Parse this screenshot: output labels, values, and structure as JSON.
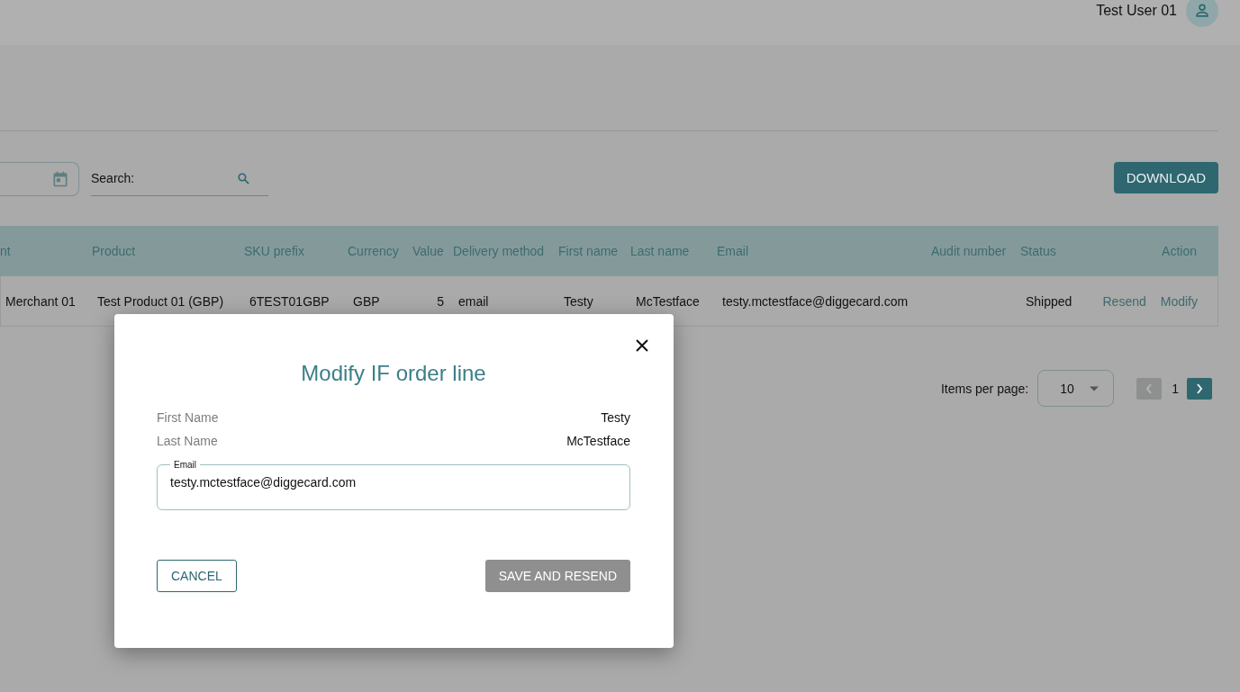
{
  "header": {
    "user_name": "Test User 01"
  },
  "filters": {
    "search": {
      "label": "Search:"
    },
    "download": "DOWNLOAD"
  },
  "table": {
    "columns": [
      "nt",
      "Product",
      "SKU prefix",
      "Currency",
      "Value",
      "Delivery method",
      "First name",
      "Last name",
      "Email",
      "Audit number",
      "Status",
      "Action"
    ],
    "rows": [
      {
        "cells": [
          "Merchant 01",
          "Test Product 01 (GBP)",
          "6TEST01GBP",
          "GBP",
          "5",
          "email",
          "Testy",
          "McTestface",
          "testy.mctestface@diggecard.com",
          "",
          "Shipped"
        ],
        "actions": [
          "Resend",
          "Modify"
        ]
      }
    ]
  },
  "pagination": {
    "label": "Items per page:",
    "per_page": "10",
    "page": "1",
    "prev_disabled": true,
    "next_disabled": false
  },
  "dialog": {
    "title": "Modify IF order line",
    "fields": [
      {
        "label": "First Name",
        "value": "Testy"
      },
      {
        "label": "Last Name",
        "value": "McTestface"
      }
    ],
    "email": {
      "label": "Email",
      "value": "testy.mctestface@diggecard.com"
    },
    "buttons": [
      {
        "label": "CANCEL",
        "kind": "outline",
        "disabled": false
      },
      {
        "label": "SAVE AND RESEND",
        "kind": "filled",
        "disabled": true
      }
    ]
  }
}
